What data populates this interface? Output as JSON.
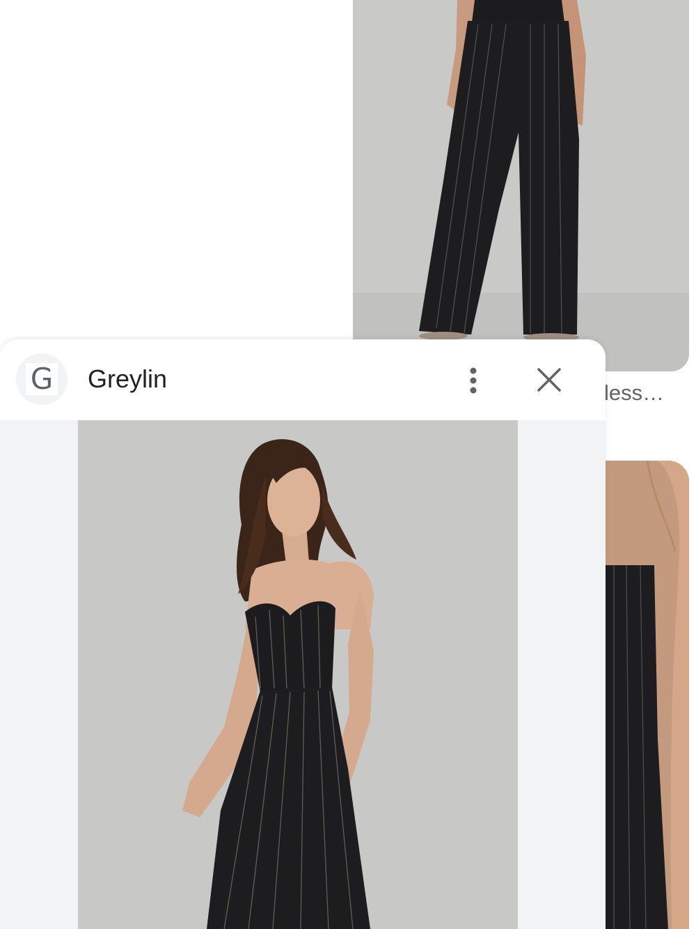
{
  "background": {
    "caption_fragment": "less…"
  },
  "panel": {
    "site_initial": "G",
    "site_name": "Greylin",
    "icons": {
      "site_logo": "site-logo-icon",
      "more": "more-vert-icon",
      "close": "close-icon"
    }
  },
  "colors": {
    "panel_background": "#ffffff",
    "image_area_background": "#f1f3f4",
    "text_primary": "#202124",
    "text_secondary": "#5f6368"
  }
}
